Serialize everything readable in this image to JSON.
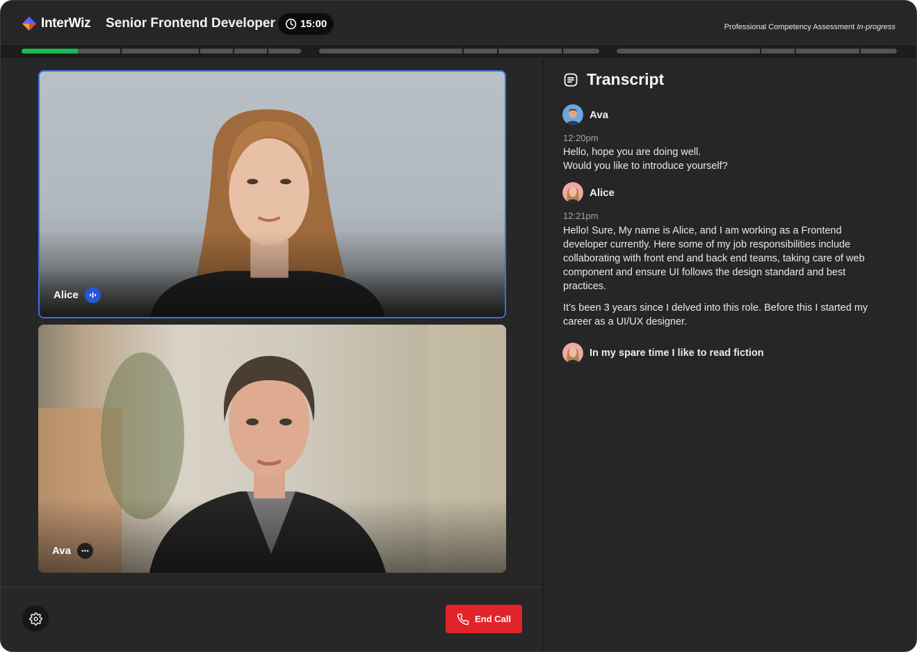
{
  "header": {
    "brand": "InterWiz",
    "job_title": "Senior Frontend Developer",
    "timer": "15:00",
    "assessment_label": "Professional Competency Assessment",
    "assessment_status": "In-progress"
  },
  "progress": {
    "sections": [
      {
        "segments": [
          0.36,
          0.28,
          0.12,
          0.12,
          0.12
        ],
        "completed_fraction": 0.2
      },
      {
        "segments": [
          0.52,
          0.12,
          0.23,
          0.13
        ],
        "completed_fraction": 0
      },
      {
        "segments": [
          0.52,
          0.12,
          0.23,
          0.13
        ],
        "completed_fraction": 0
      }
    ],
    "accent": "#1db954"
  },
  "video": {
    "participants": [
      {
        "name": "Alice",
        "status_icon": "speaking-icon",
        "active": true
      },
      {
        "name": "Ava",
        "status_icon": "more-dots-icon",
        "active": false
      }
    ]
  },
  "controls": {
    "settings_icon": "gear-icon",
    "end_call_label": "End Call",
    "end_call_color": "#e1242a"
  },
  "transcript": {
    "title": "Transcript",
    "messages": [
      {
        "speaker": "Ava",
        "time": "12:20pm",
        "lines": [
          "Hello, hope you are doing well.",
          "Would you like to introduce yourself?"
        ]
      },
      {
        "speaker": "Alice",
        "time": "12:21pm",
        "paragraphs": [
          "Hello! Sure, My name is Alice, and I am working as a Frontend developer currently. Here some of my job responsibilities include collaborating with front end and back end teams, taking care of web component and ensure UI follows the design standard and best practices.",
          "It’s been 3 years since I delved into this role. Before this I started my career as a UI/UX designer."
        ]
      },
      {
        "speaker": "Alice",
        "text": "In my spare time I like to read fiction"
      }
    ]
  }
}
